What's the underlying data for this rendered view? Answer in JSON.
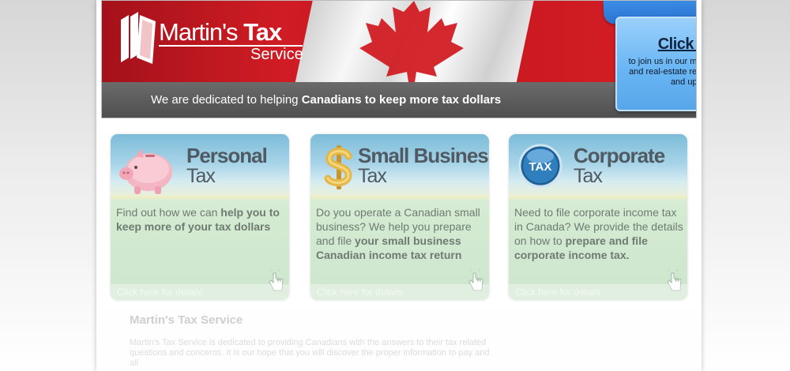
{
  "header": {
    "logo": {
      "name_prefix": "Martin's ",
      "name_bold": "Tax",
      "subtitle": "Service"
    },
    "tagline": {
      "prefix": "We are dedicated to helping ",
      "bold": "Canadians to keep more tax dollars"
    },
    "callout": {
      "title": "Click here",
      "text": "to join us in our mailing list for Tax and real-estate related free report and update!"
    }
  },
  "cards": [
    {
      "title_line1": "Personal",
      "title_line2": "Tax",
      "icon": "piggy-bank-icon",
      "body_prefix": "Find out how we can ",
      "body_bold": "help you to keep more of your tax dollars",
      "body_mid": "",
      "body_bold2": "",
      "footer": "Click here for details"
    },
    {
      "title_line1": "Small Business",
      "title_line2": "Tax",
      "icon": "dollar-sign-icon",
      "body_prefix": "Do you operate a Canadian small business? We help you prepare and file ",
      "body_bold": "your small business Canadian income tax return",
      "body_mid": "",
      "body_bold2": "",
      "footer": "Click here for details"
    },
    {
      "title_line1": "Corporate",
      "title_line2": "Tax",
      "icon": "tax-orb-icon",
      "body_prefix": "Need to file corporate income tax in Canada? We provide the details on how to ",
      "body_bold": "prepare and file corporate income tax.",
      "body_mid": "",
      "body_bold2": "",
      "footer": "Click here for details"
    }
  ],
  "about": {
    "title": "Martin's Tax Service",
    "text": "Martin's Tax Service is dedicated to providing Canadians with the answers to their tax related questions and concerns. It is our hope that you will discover the proper information to pay and all"
  },
  "colors": {
    "banner_red": "#d01c24",
    "tagline_bar": "#555555",
    "callout_blue": "#6ab6f4",
    "card_green": "#d2ead0",
    "card_title": "#4f5a62"
  }
}
